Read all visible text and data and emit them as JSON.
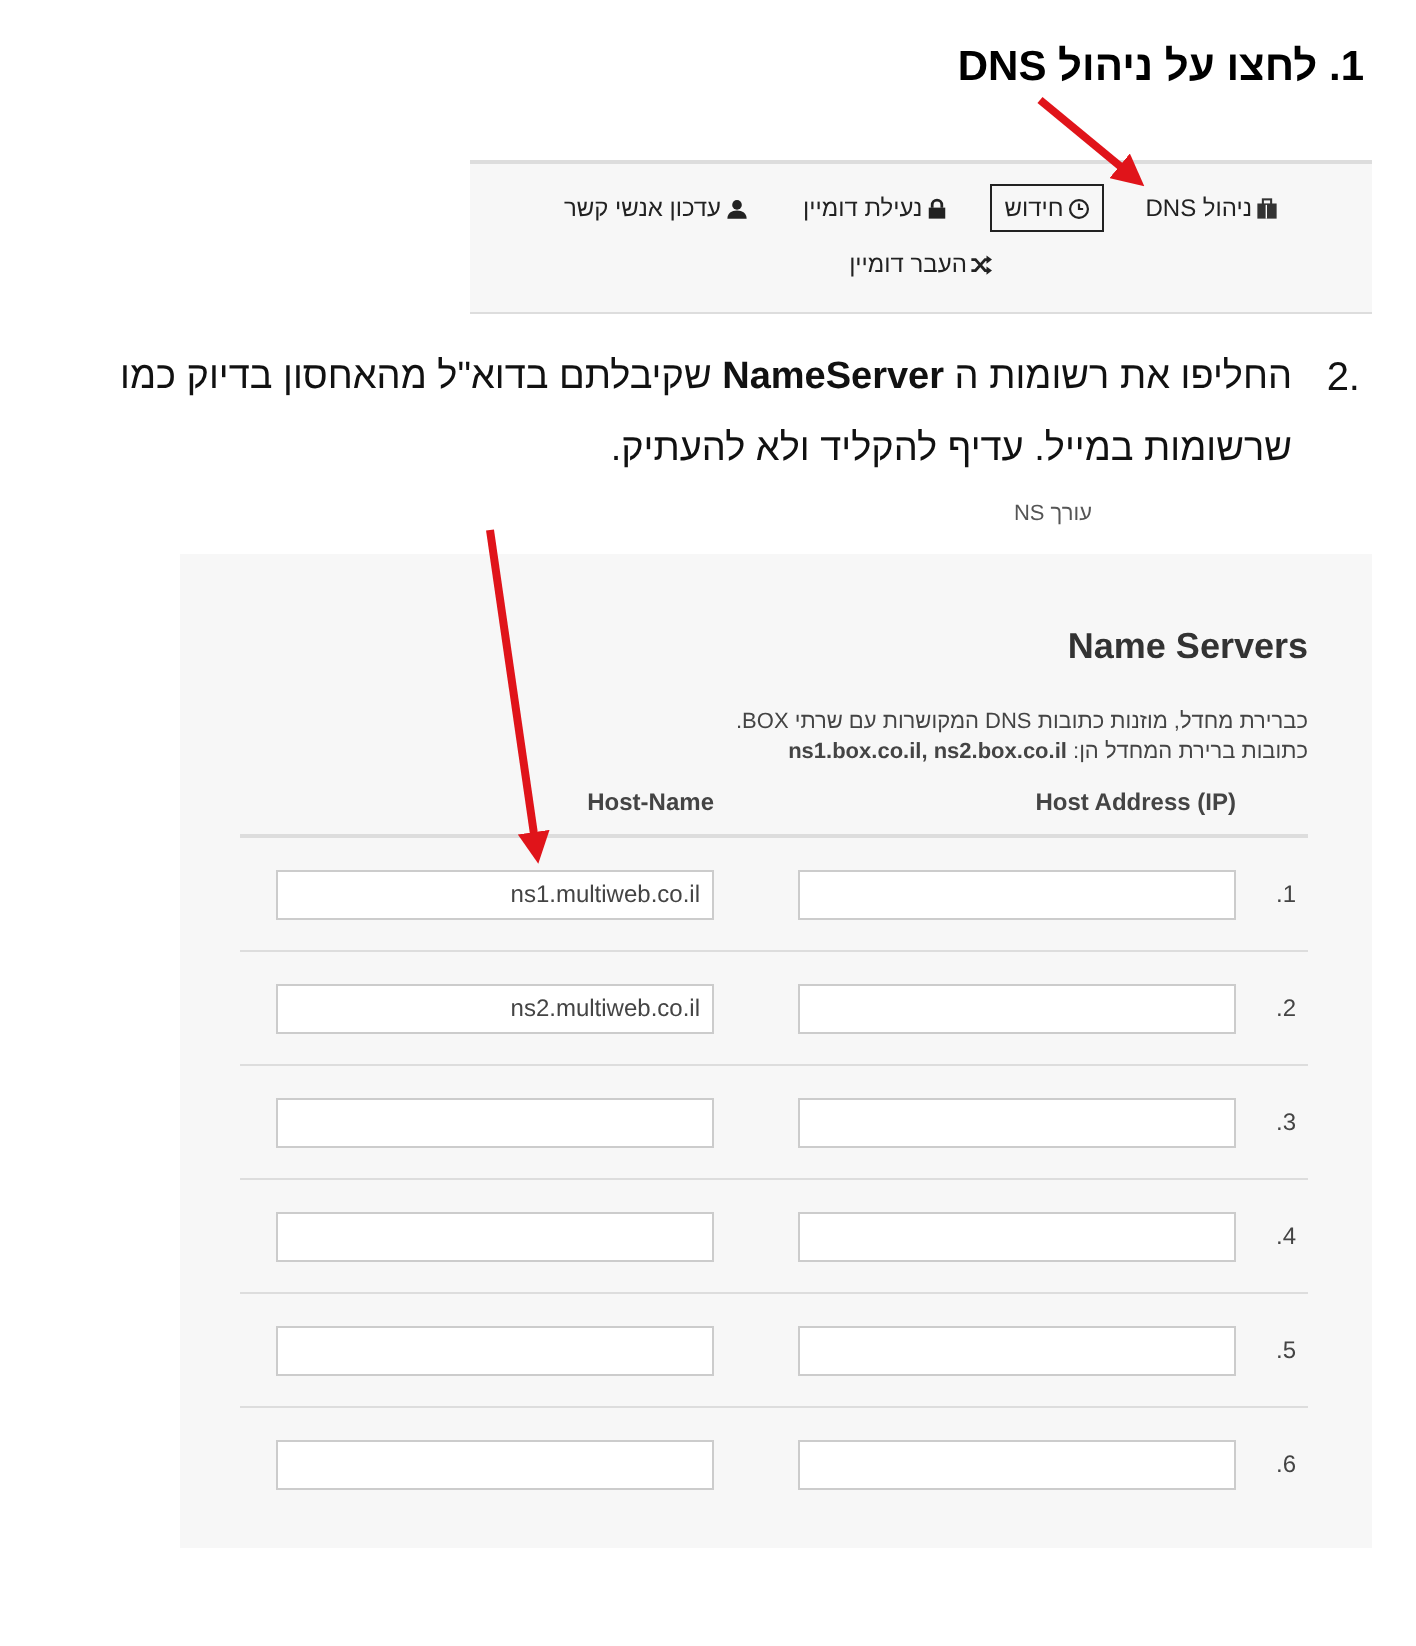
{
  "step_1": {
    "number": "1.",
    "text": "לחצו על ניהול DNS"
  },
  "domain_menu": {
    "items": [
      {
        "label": "ניהול DNS",
        "selected": false
      },
      {
        "label": "חידוש",
        "selected": true
      },
      {
        "label": "נעילת דומיין",
        "selected": false
      },
      {
        "label": "עדכון אנשי קשר",
        "selected": false
      },
      {
        "label": "העבר דומיין",
        "selected": false
      }
    ]
  },
  "step_2": {
    "number": "2.",
    "text": "החליפו את רשומות ה  **NameServer**  שקיבלתם בדוא\"ל מהאחסון בדיוק כמו שרשומות במייל. עדיף להקליד ולא להעתיק."
  },
  "breadcrumb": "עורך NS",
  "name_servers": {
    "title": "Name Servers",
    "description": [
      "כברירת מחדל, מוזנות כתובות DNS המקושרות עם שרתי BOX.",
      "כתובות ברירת המחדל הן: **ns1.box.co.il, ns2.box.co.il**"
    ],
    "columns": [
      "Host Address (IP)",
      "Host-Name"
    ],
    "rows": [
      {
        "number": "1.",
        "host_name": "ns1.multiweb.co.il"
      },
      {
        "number": "2.",
        "host_name": "ns2.multiweb.co.il"
      },
      {
        "number": "3."
      },
      {
        "number": "4."
      },
      {
        "number": "5."
      },
      {
        "number": "6."
      }
    ]
  }
}
